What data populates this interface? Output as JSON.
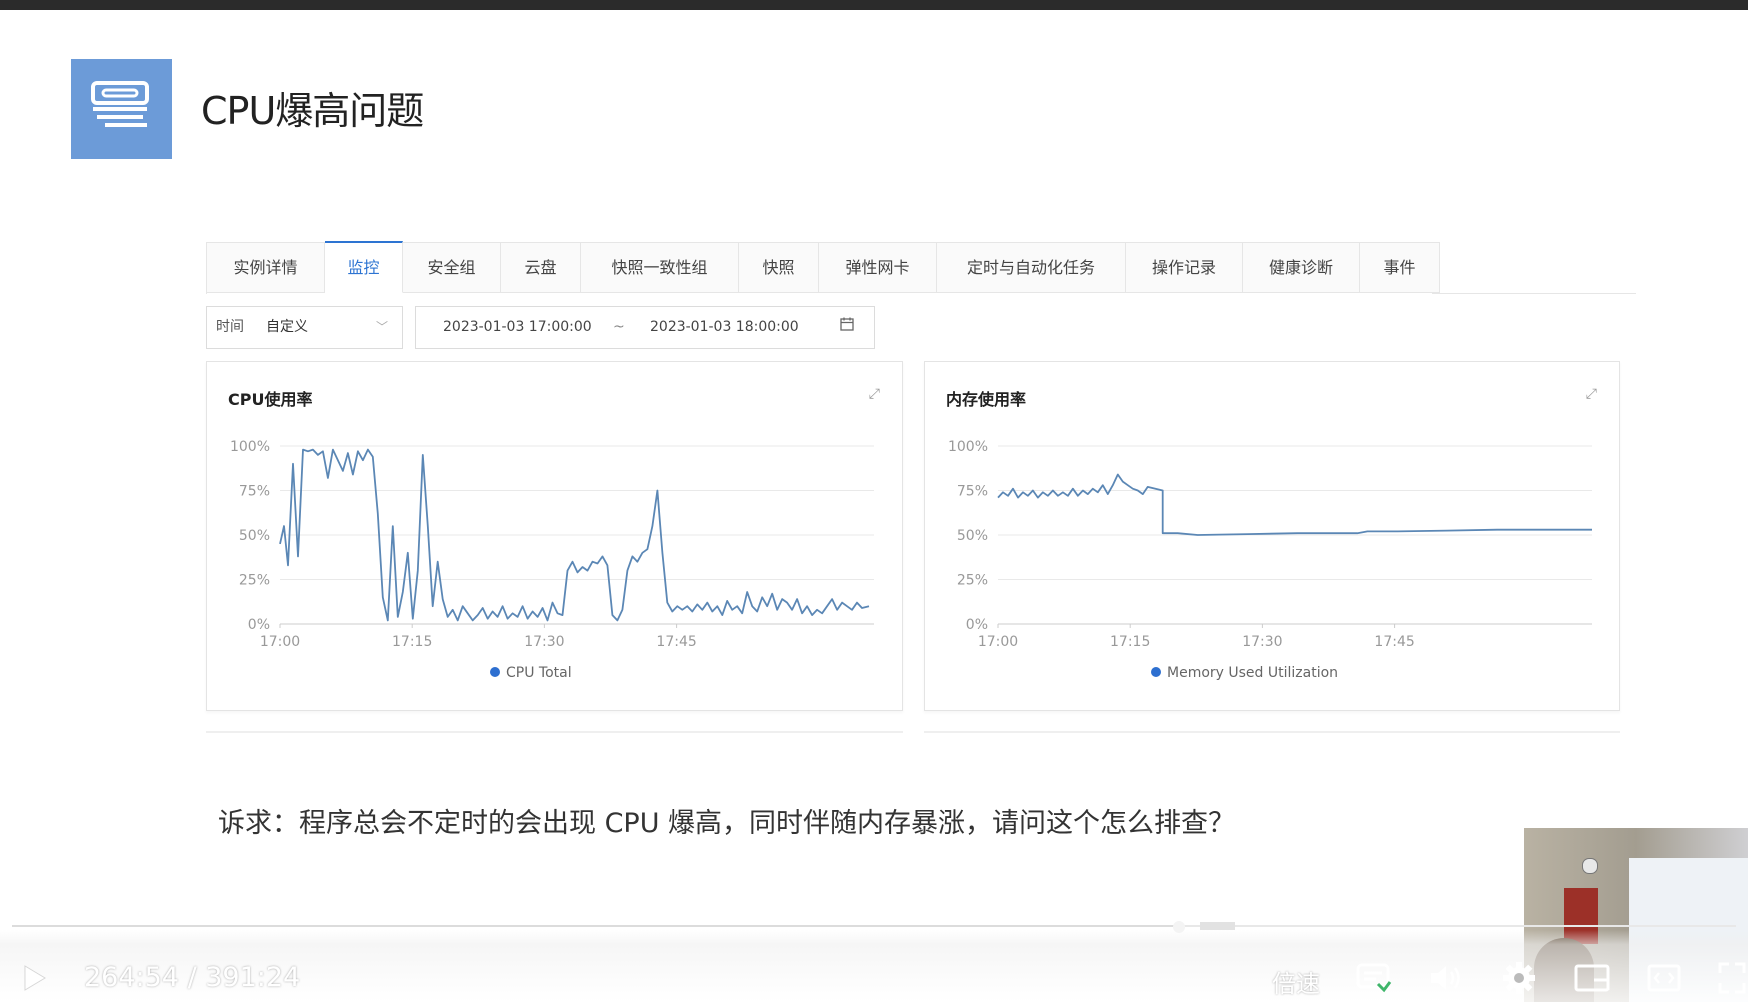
{
  "slide": {
    "title": "CPU爆高问题",
    "question": "诉求：程序总会不定时的会出现 CPU 爆高，同时伴随内存暴涨，请问这个怎么排查？"
  },
  "console": {
    "tabs": [
      "实例详情",
      "监控",
      "安全组",
      "云盘",
      "快照一致性组",
      "快照",
      "弹性网卡",
      "定时与自动化任务",
      "操作记录",
      "健康诊断",
      "事件"
    ],
    "active_tab": "监控",
    "time_label": "时间",
    "time_mode": "自定义",
    "start_time": "2023-01-03 17:00:00",
    "range_separator": "~",
    "end_time": "2023-01-03 18:00:00",
    "accent_color": "#2d74d2"
  },
  "chart_data": [
    {
      "type": "line",
      "title": "CPU使用率",
      "x": [
        "17:00",
        "17:15",
        "17:30",
        "17:45"
      ],
      "ylim": [
        0,
        100
      ],
      "yticks": [
        "100%",
        "75%",
        "50%",
        "25%",
        "0%"
      ],
      "grid": true,
      "legend_position": "bottom",
      "series": [
        {
          "name": "CPU Total",
          "color": "#5b87b5",
          "points": [
            [
              0,
              45
            ],
            [
              0.4,
              55
            ],
            [
              0.8,
              33
            ],
            [
              1.3,
              90
            ],
            [
              1.8,
              38
            ],
            [
              2.3,
              98
            ],
            [
              2.8,
              97
            ],
            [
              3.3,
              98
            ],
            [
              3.8,
              95
            ],
            [
              4.3,
              97
            ],
            [
              4.8,
              82
            ],
            [
              5.3,
              98
            ],
            [
              5.8,
              92
            ],
            [
              6.3,
              86
            ],
            [
              6.8,
              96
            ],
            [
              7.3,
              84
            ],
            [
              7.8,
              97
            ],
            [
              8.3,
              92
            ],
            [
              8.8,
              98
            ],
            [
              9.3,
              94
            ],
            [
              9.8,
              62
            ],
            [
              10.3,
              15
            ],
            [
              10.8,
              2
            ],
            [
              11.3,
              55
            ],
            [
              11.8,
              4
            ],
            [
              12.3,
              18
            ],
            [
              12.8,
              40
            ],
            [
              13.3,
              3
            ],
            [
              13.8,
              30
            ],
            [
              14.3,
              95
            ],
            [
              14.8,
              55
            ],
            [
              15.3,
              10
            ],
            [
              15.8,
              35
            ],
            [
              16.3,
              14
            ],
            [
              16.8,
              4
            ],
            [
              17.3,
              8
            ],
            [
              17.8,
              2
            ],
            [
              18.3,
              10
            ],
            [
              18.8,
              6
            ],
            [
              19.3,
              2
            ],
            [
              19.8,
              5
            ],
            [
              20.3,
              9
            ],
            [
              20.8,
              3
            ],
            [
              21.3,
              7
            ],
            [
              21.8,
              4
            ],
            [
              22.3,
              10
            ],
            [
              22.8,
              3
            ],
            [
              23.3,
              6
            ],
            [
              23.8,
              4
            ],
            [
              24.3,
              10
            ],
            [
              24.8,
              3
            ],
            [
              25.3,
              7
            ],
            [
              25.8,
              4
            ],
            [
              26.3,
              9
            ],
            [
              26.8,
              2
            ],
            [
              27.3,
              12
            ],
            [
              27.8,
              6
            ],
            [
              28.3,
              5
            ],
            [
              28.8,
              30
            ],
            [
              29.3,
              35
            ],
            [
              29.8,
              29
            ],
            [
              30.3,
              32
            ],
            [
              30.8,
              30
            ],
            [
              31.3,
              35
            ],
            [
              31.8,
              34
            ],
            [
              32.3,
              38
            ],
            [
              32.8,
              33
            ],
            [
              33.3,
              5
            ],
            [
              33.8,
              2
            ],
            [
              34.3,
              8
            ],
            [
              34.8,
              30
            ],
            [
              35.3,
              38
            ],
            [
              35.8,
              35
            ],
            [
              36.3,
              40
            ],
            [
              36.8,
              42
            ],
            [
              37.3,
              55
            ],
            [
              37.8,
              75
            ],
            [
              38.3,
              40
            ],
            [
              38.8,
              12
            ],
            [
              39.3,
              7
            ],
            [
              39.8,
              10
            ],
            [
              40.3,
              8
            ],
            [
              40.8,
              10
            ],
            [
              41.3,
              7
            ],
            [
              41.8,
              11
            ],
            [
              42.3,
              8
            ],
            [
              42.8,
              12
            ],
            [
              43.3,
              7
            ],
            [
              43.8,
              10
            ],
            [
              44.3,
              5
            ],
            [
              44.8,
              13
            ],
            [
              45.3,
              8
            ],
            [
              45.8,
              10
            ],
            [
              46.3,
              6
            ],
            [
              46.8,
              18
            ],
            [
              47.3,
              10
            ],
            [
              47.8,
              7
            ],
            [
              48.3,
              15
            ],
            [
              48.8,
              10
            ],
            [
              49.3,
              17
            ],
            [
              49.8,
              8
            ],
            [
              50.3,
              14
            ],
            [
              50.8,
              12
            ],
            [
              51.3,
              8
            ],
            [
              51.8,
              14
            ],
            [
              52.3,
              6
            ],
            [
              52.8,
              10
            ],
            [
              53.3,
              5
            ],
            [
              53.8,
              8
            ],
            [
              54.3,
              6
            ],
            [
              54.8,
              10
            ],
            [
              55.3,
              14
            ],
            [
              55.8,
              8
            ],
            [
              56.3,
              12
            ],
            [
              56.8,
              10
            ],
            [
              57.3,
              8
            ],
            [
              57.8,
              12
            ],
            [
              58.3,
              9
            ],
            [
              59.0,
              10
            ]
          ]
        }
      ]
    },
    {
      "type": "line",
      "title": "内存使用率",
      "x": [
        "17:00",
        "17:15",
        "17:30",
        "17:45"
      ],
      "ylim": [
        0,
        100
      ],
      "yticks": [
        "100%",
        "75%",
        "50%",
        "25%",
        "0%"
      ],
      "grid": true,
      "legend_position": "bottom",
      "series": [
        {
          "name": "Memory Used Utilization",
          "color": "#5b87b5",
          "points": [
            [
              0,
              71
            ],
            [
              0.5,
              74
            ],
            [
              1,
              72
            ],
            [
              1.5,
              76
            ],
            [
              2,
              71
            ],
            [
              2.5,
              74
            ],
            [
              3,
              72
            ],
            [
              3.5,
              75
            ],
            [
              4,
              71
            ],
            [
              4.5,
              74
            ],
            [
              5,
              72
            ],
            [
              5.5,
              75
            ],
            [
              6,
              72
            ],
            [
              6.5,
              74
            ],
            [
              7,
              72
            ],
            [
              7.5,
              76
            ],
            [
              8,
              72
            ],
            [
              8.5,
              75
            ],
            [
              9,
              73
            ],
            [
              9.5,
              76
            ],
            [
              10,
              74
            ],
            [
              10.5,
              78
            ],
            [
              11,
              73
            ],
            [
              11.5,
              78
            ],
            [
              12,
              84
            ],
            [
              12.5,
              80
            ],
            [
              13,
              78
            ],
            [
              13.5,
              76
            ],
            [
              14,
              75
            ],
            [
              14.5,
              73
            ],
            [
              15,
              77
            ],
            [
              16.5,
              75
            ],
            [
              16.5,
              51
            ],
            [
              18,
              51
            ],
            [
              20,
              50
            ],
            [
              25,
              50.5
            ],
            [
              30,
              51
            ],
            [
              36,
              51
            ],
            [
              37,
              52
            ],
            [
              40,
              52
            ],
            [
              45,
              52.5
            ],
            [
              50,
              53
            ],
            [
              55,
              53
            ],
            [
              59.5,
              53
            ]
          ]
        }
      ]
    }
  ],
  "player": {
    "time": "264:54 / 391:24",
    "speed_label": "倍速",
    "progress_fraction": 0.677
  }
}
